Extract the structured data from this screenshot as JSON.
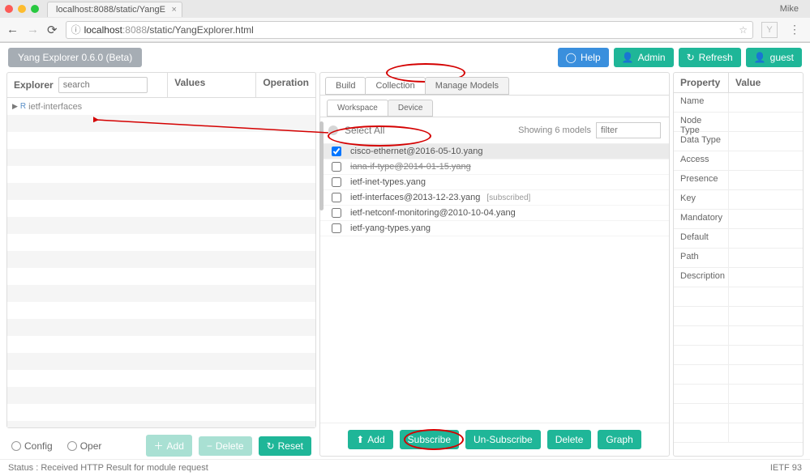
{
  "browser": {
    "tab_title": "localhost:8088/static/YangE",
    "user": "Mike",
    "url_host": "localhost",
    "url_port": ":8088",
    "url_path": "/static/YangExplorer.html"
  },
  "toolbar": {
    "version": "Yang Explorer 0.6.0 (Beta)",
    "help": "Help",
    "admin": "Admin",
    "refresh": "Refresh",
    "guest": "guest"
  },
  "left": {
    "explorer": "Explorer",
    "values": "Values",
    "operation": "Operation",
    "search_placeholder": "search",
    "tree_item": "ietf-interfaces",
    "config": "Config",
    "oper": "Oper",
    "add": "Add",
    "delete": "Delete",
    "reset": "Reset"
  },
  "center": {
    "tabs": {
      "build": "Build",
      "collections": "Collection",
      "manage": "Manage Models"
    },
    "subtabs": {
      "workspace": "Workspace",
      "device": "Device"
    },
    "select_all": "Select All",
    "showing": "Showing 6 models",
    "filter_placeholder": "filter",
    "models": [
      {
        "name": "cisco-ethernet@2016-05-10.yang",
        "checked": true,
        "strike": false,
        "sub": ""
      },
      {
        "name": "iana-if-type@2014-01-15.yang",
        "checked": false,
        "strike": true,
        "sub": ""
      },
      {
        "name": "ietf-inet-types.yang",
        "checked": false,
        "strike": false,
        "sub": ""
      },
      {
        "name": "ietf-interfaces@2013-12-23.yang",
        "checked": false,
        "strike": false,
        "sub": "[subscribed]"
      },
      {
        "name": "ietf-netconf-monitoring@2010-10-04.yang",
        "checked": false,
        "strike": false,
        "sub": ""
      },
      {
        "name": "ietf-yang-types.yang",
        "checked": false,
        "strike": false,
        "sub": ""
      }
    ],
    "buttons": {
      "add": "Add",
      "subscribe": "Subscribe",
      "unsubscribe": "Un-Subscribe",
      "delete": "Delete",
      "graph": "Graph"
    }
  },
  "right": {
    "property": "Property",
    "value": "Value",
    "rows": [
      "Name",
      "Node Type",
      "Data Type",
      "Access",
      "Presence",
      "Key",
      "Mandatory",
      "Default",
      "Path",
      "Description"
    ]
  },
  "status": {
    "left": "Status : Received HTTP Result for module request",
    "right": "IETF 93"
  }
}
